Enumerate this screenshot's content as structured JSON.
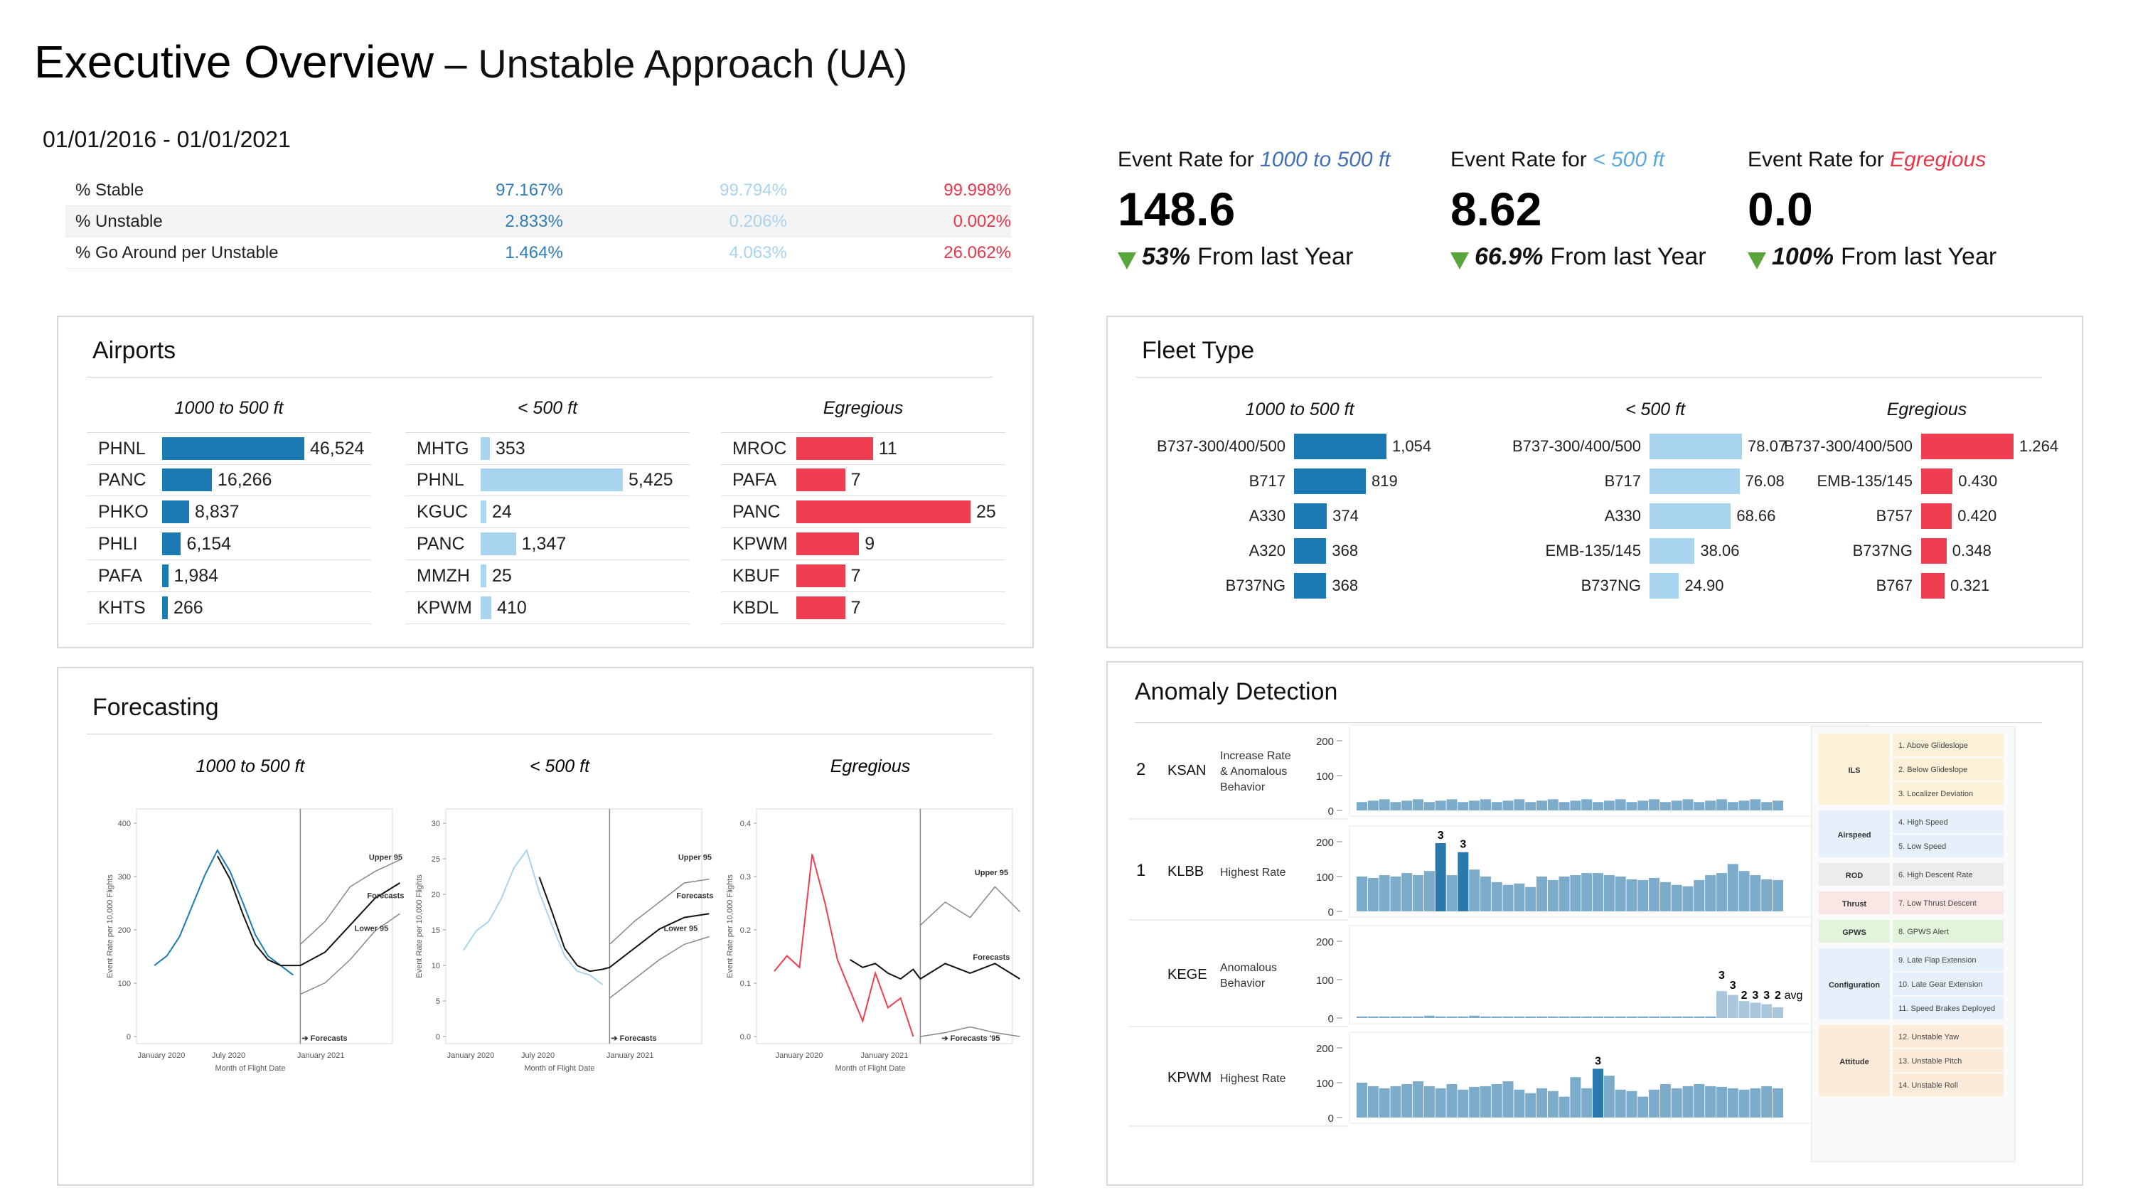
{
  "header": {
    "title": "Executive Overview",
    "subtitle": " – Unstable Approach (UA)",
    "date_range": "01/01/2016 - 01/01/2021"
  },
  "summary": {
    "rows": [
      {
        "label": "% Stable",
        "v1": "97.167%",
        "v2": "99.794%",
        "v3": "99.998%"
      },
      {
        "label": "% Unstable",
        "v1": "2.833%",
        "v2": "0.206%",
        "v3": "0.002%"
      },
      {
        "label": "% Go Around per Unstable",
        "v1": "1.464%",
        "v2": "4.063%",
        "v3": "26.062%"
      }
    ]
  },
  "colors": {
    "dark_blue": "#1a7bb3",
    "light_blue": "#a8d4ef",
    "red": "#ef3e4f",
    "green": "#5aa43c",
    "anomaly_bar": "#7daccb",
    "anomaly_highlight": "#2a79ac"
  },
  "kpis": [
    {
      "title_prefix": "Event Rate for ",
      "title_em": "1000 to 500 ft",
      "color": "#4270b8",
      "value": "148.6",
      "pct": "53%",
      "change_text": "From last Year"
    },
    {
      "title_prefix": "Event Rate for ",
      "title_em": "< 500 ft",
      "color": "#5aa8de",
      "value": "8.62",
      "pct": "66.9%",
      "change_text": "From last Year"
    },
    {
      "title_prefix": "Event Rate for ",
      "title_em": "Egregious",
      "color": "#e8364a",
      "value": "0.0",
      "pct": "100%",
      "change_text": "From last Year"
    }
  ],
  "airports": {
    "title": "Airports",
    "columns": [
      {
        "head": "1000 to 500 ft",
        "rows": [
          {
            "code": "PHNL",
            "value": 46524,
            "label": "46,524"
          },
          {
            "code": "PANC",
            "value": 16266,
            "label": "16,266"
          },
          {
            "code": "PHKO",
            "value": 8837,
            "label": "8,837"
          },
          {
            "code": "PHLI",
            "value": 6154,
            "label": "6,154"
          },
          {
            "code": "PAFA",
            "value": 1984,
            "label": "1,984"
          },
          {
            "code": "KHTS",
            "value": 266,
            "label": "266"
          }
        ]
      },
      {
        "head": "< 500 ft",
        "rows": [
          {
            "code": "MHTG",
            "value": 353,
            "label": "353"
          },
          {
            "code": "PHNL",
            "value": 5425,
            "label": "5,425"
          },
          {
            "code": "KGUC",
            "value": 24,
            "label": "24"
          },
          {
            "code": "PANC",
            "value": 1347,
            "label": "1,347"
          },
          {
            "code": "MMZH",
            "value": 25,
            "label": "25"
          },
          {
            "code": "KPWM",
            "value": 410,
            "label": "410"
          }
        ]
      },
      {
        "head": "Egregious",
        "rows": [
          {
            "code": "MROC",
            "value": 11,
            "label": "11"
          },
          {
            "code": "PAFA",
            "value": 7,
            "label": "7"
          },
          {
            "code": "PANC",
            "value": 25,
            "label": "25"
          },
          {
            "code": "KPWM",
            "value": 9,
            "label": "9"
          },
          {
            "code": "KBUF",
            "value": 7,
            "label": "7"
          },
          {
            "code": "KBDL",
            "value": 7,
            "label": "7"
          }
        ]
      }
    ]
  },
  "fleet": {
    "title": "Fleet Type",
    "columns": [
      {
        "head": "1000 to 500 ft",
        "rows": [
          {
            "type": "B737-300/400/500",
            "value": 1054,
            "label": "1,054"
          },
          {
            "type": "B717",
            "value": 819,
            "label": "819"
          },
          {
            "type": "A330",
            "value": 374,
            "label": "374"
          },
          {
            "type": "A320",
            "value": 368,
            "label": "368"
          },
          {
            "type": "B737NG",
            "value": 368,
            "label": "368"
          }
        ]
      },
      {
        "head": "< 500 ft",
        "rows": [
          {
            "type": "B737-300/400/500",
            "value": 78.07,
            "label": "78.07"
          },
          {
            "type": "B717",
            "value": 76.08,
            "label": "76.08"
          },
          {
            "type": "A330",
            "value": 68.66,
            "label": "68.66"
          },
          {
            "type": "EMB-135/145",
            "value": 38.06,
            "label": "38.06"
          },
          {
            "type": "B737NG",
            "value": 24.9,
            "label": "24.90"
          }
        ]
      },
      {
        "head": "Egregious",
        "rows": [
          {
            "type": "B737-300/400/500",
            "value": 1.264,
            "label": "1.264"
          },
          {
            "type": "EMB-135/145",
            "value": 0.43,
            "label": "0.430"
          },
          {
            "type": "B757",
            "value": 0.42,
            "label": "0.420"
          },
          {
            "type": "B737NG",
            "value": 0.348,
            "label": "0.348"
          },
          {
            "type": "B767",
            "value": 0.321,
            "label": "0.321"
          }
        ]
      }
    ]
  },
  "forecasting": {
    "title": "Forecasting",
    "charts": [
      {
        "head": "1000 to 500 ft",
        "ylabel": "Event Rate per 10,000 Flights",
        "xlabel": "Month of Flight Date",
        "xticks": [
          "January 2020",
          "July 2020",
          "January 2021"
        ],
        "yticks": [
          "0",
          "100",
          "200",
          "300",
          "400"
        ],
        "ymax": 470,
        "annotations": [
          "Upper 95",
          "Forecasts",
          "Lower 95",
          "➔ Forecasts"
        ]
      },
      {
        "head": "< 500 ft",
        "ylabel": "Event Rate per 10,000 Flights",
        "xlabel": "Month of Flight Date",
        "xticks": [
          "January 2020",
          "July 2020",
          "January 2021"
        ],
        "yticks": [
          "0",
          "5",
          "10",
          "15",
          "20",
          "25",
          "30"
        ],
        "ymax": 31,
        "annotations": [
          "Upper 95",
          "Forecasts",
          "Lower 95",
          "➔ Forecasts"
        ]
      },
      {
        "head": "Egregious",
        "ylabel": "Event Rate per 10,000 Flights",
        "xlabel": "Month of Flight Date",
        "xticks": [
          "January 2020",
          "January 2021"
        ],
        "yticks": [
          "0.0",
          "0.1",
          "0.2",
          "0.3",
          "0.4"
        ],
        "ymax": 0.44,
        "annotations": [
          "Upper 95",
          "Forecasts",
          "➔ Forecasts '95"
        ]
      }
    ]
  },
  "anomaly": {
    "title": "Anomaly Detection",
    "rows": [
      {
        "rank": "2",
        "airport": "KSAN",
        "reason": [
          "Increase Rate",
          "& Anomalous",
          "Behavior"
        ],
        "yticks": [
          "0",
          "100",
          "200"
        ]
      },
      {
        "rank": "1",
        "airport": "KLBB",
        "reason": [
          "Highest Rate"
        ],
        "yticks": [
          "0",
          "100",
          "200"
        ],
        "labels": [
          "3",
          "3"
        ]
      },
      {
        "rank": "",
        "airport": "KEGE",
        "reason": [
          "Anomalous",
          "Behavior"
        ],
        "yticks": [
          "0",
          "100",
          "200"
        ],
        "labels": [
          "3",
          "3",
          "2",
          "3",
          "3",
          "2",
          "avg"
        ]
      },
      {
        "rank": "",
        "airport": "KPWM",
        "reason": [
          "Highest Rate"
        ],
        "yticks": [
          "0",
          "100",
          "200"
        ],
        "labels": [
          "3"
        ]
      }
    ],
    "legend": [
      {
        "group": "ILS",
        "color": "#fbf1d8",
        "items": [
          "1. Above Glideslope",
          "2. Below Glideslope",
          "3. Localizer Deviation"
        ]
      },
      {
        "group": "Airspeed",
        "color": "#e6f0fb",
        "items": [
          "4. High Speed",
          "5. Low Speed"
        ]
      },
      {
        "group": "ROD",
        "color": "#ececec",
        "items": [
          "6. High Descent Rate"
        ]
      },
      {
        "group": "Thrust",
        "color": "#fbe6e6",
        "items": [
          "7. Low Thrust Descent"
        ]
      },
      {
        "group": "GPWS",
        "color": "#e3f4dd",
        "items": [
          "8. GPWS Alert"
        ]
      },
      {
        "group": "Configuration",
        "color": "#e6f0fb",
        "items": [
          "9. Late Flap Extension",
          "10. Late Gear Extension",
          "11. Speed Brakes Deployed"
        ]
      },
      {
        "group": "Attitude",
        "color": "#fcebd9",
        "items": [
          "12. Unstable Yaw",
          "13. Unstable Pitch",
          "14. Unstable Roll"
        ]
      }
    ]
  }
}
